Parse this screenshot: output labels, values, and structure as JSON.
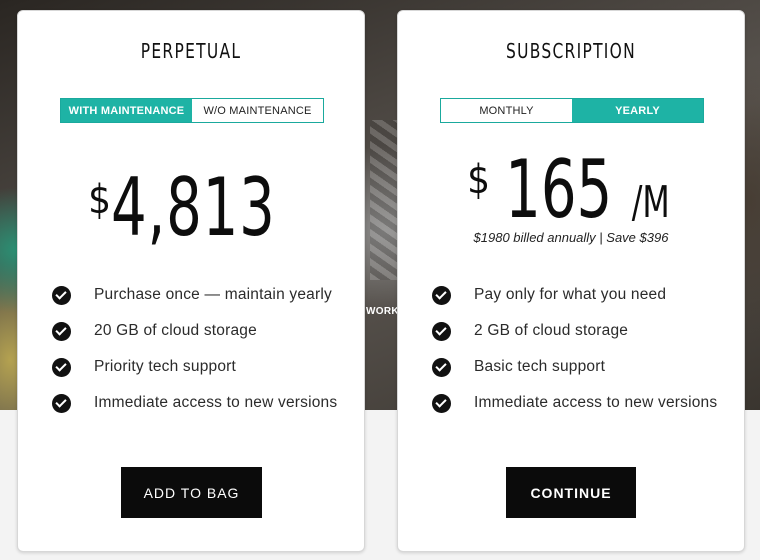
{
  "background_text": "WORKS",
  "colors": {
    "accent": "#1eb3a5",
    "button_bg": "#0b0b0b",
    "text": "#111111"
  },
  "perpetual": {
    "title": "PERPETUAL",
    "toggle": {
      "option_1": "WITH MAINTENANCE",
      "option_2": "W/O MAINTENANCE",
      "selected": "WITH MAINTENANCE"
    },
    "price": {
      "currency": "$",
      "amount": "4,813"
    },
    "features": [
      "Purchase once — maintain yearly",
      "20 GB of cloud storage",
      "Priority tech support",
      "Immediate access to new versions"
    ],
    "check_icon": "checkmark-circle-icon",
    "button_label": "ADD TO BAG"
  },
  "subscription": {
    "title": "SUBSCRIPTION",
    "toggle": {
      "option_1": "MONTHLY",
      "option_2": "YEARLY",
      "selected": "YEARLY"
    },
    "price": {
      "currency": "$",
      "amount": "165",
      "period": "/M"
    },
    "billing_note": "$1980 billed annually | Save $396",
    "features": [
      "Pay only for what you need",
      "2 GB of cloud storage",
      "Basic tech support",
      "Immediate access to new versions"
    ],
    "check_icon": "checkmark-circle-icon",
    "button_label": "CONTINUE"
  }
}
